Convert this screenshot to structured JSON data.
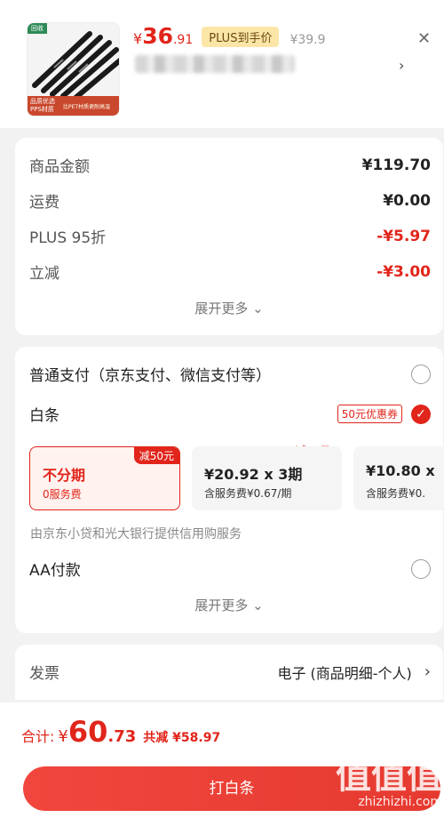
{
  "product": {
    "thumb_tag": "回收",
    "thumb_line1": "品质优选",
    "thumb_line2": "PPS材质",
    "thumb_line3": "比PET材质更耐高温",
    "price_symbol": "¥",
    "price_int": "36",
    "price_dec": ".91",
    "plus_label": "PLUS到手价",
    "original_price": "¥39.9",
    "close_icon": "close-icon",
    "arrow_icon": "chevron-right-icon"
  },
  "summary": {
    "rows": [
      {
        "label": "商品金额",
        "value": "¥119.70"
      },
      {
        "label": "运费",
        "value": "¥0.00"
      },
      {
        "label": "PLUS 95折",
        "value": "-¥5.97"
      },
      {
        "label": "立减",
        "value": "-¥3.00"
      }
    ],
    "expand": "展开更多 ⌄"
  },
  "payment": {
    "normal": "普通支付（京东支付、微信支付等）",
    "baitiao": "白条",
    "coupon": "50元优惠券",
    "installments": [
      {
        "main": "不分期",
        "sub": "0服务费",
        "tag": "减50元"
      },
      {
        "main": "¥20.92 x 3期",
        "sub": "含服务费¥0.67/期",
        "tag": "减50元"
      },
      {
        "main": "¥10.80 x",
        "sub": "含服务费¥0."
      }
    ],
    "provider": "由京东小贷和光大银行提供信用购服务",
    "aa": "AA付款",
    "expand": "展开更多 ⌄"
  },
  "invoice": {
    "label": "发票",
    "value": "电子 (商品明细-个人)",
    "arrow": "›"
  },
  "footer": {
    "total_label": "合计:",
    "total_symbol": "¥",
    "total_int": "60",
    "total_dec": ".73",
    "saved": "共减 ¥58.97",
    "pay_button": "打白条",
    "watermark_mark": "值值值",
    "watermark_text": "zhizhizhi.com"
  },
  "colors": {
    "accent": "#e1251b",
    "plus_badge": "#fbe6a7"
  }
}
